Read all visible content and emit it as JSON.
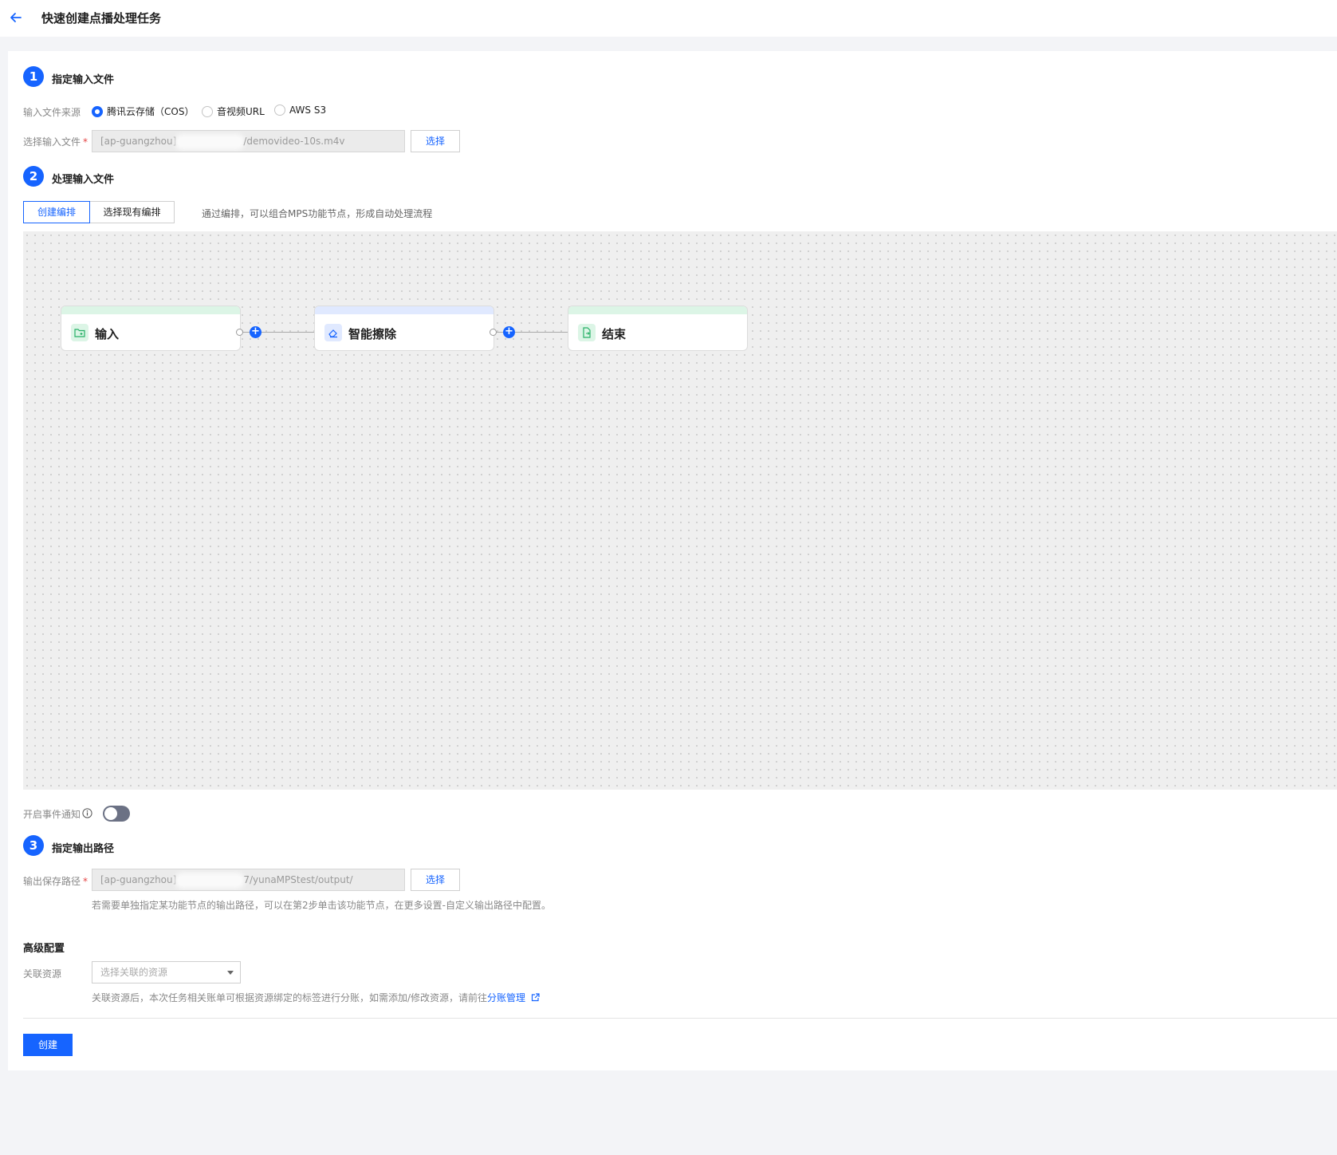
{
  "header": {
    "title": "快速创建点播处理任务"
  },
  "step1": {
    "number": "1",
    "title": "指定输入文件",
    "source_label": "输入文件来源",
    "sources": [
      "腾讯云存储（COS）",
      "音视频URL",
      "AWS S3"
    ],
    "selected_source": "腾讯云存储（COS）",
    "file_label": "选择输入文件",
    "file_prefix": "[ap-guangzhou]",
    "file_suffix": "/demovideo-10s.m4v",
    "select_button": "选择"
  },
  "step2": {
    "number": "2",
    "title": "处理输入文件",
    "tabs": [
      "创建编排",
      "选择现有编排"
    ],
    "active_tab": "创建编排",
    "hint": "通过编排，可以组合MPS功能节点，形成自动处理流程",
    "nodes": [
      {
        "label": "输入",
        "icon": "folder-add-icon",
        "color": "#dcf5e6"
      },
      {
        "label": "智能擦除",
        "icon": "eraser-icon",
        "color": "#e0e9ff"
      },
      {
        "label": "结束",
        "icon": "file-export-icon",
        "color": "#dcf5e6"
      }
    ],
    "event_notify_label": "开启事件通知",
    "event_notify_on": false
  },
  "step3": {
    "number": "3",
    "title": "指定输出路径",
    "path_label": "输出保存路径",
    "path_prefix": "[ap-guangzhou]",
    "path_suffix": "7/yunaMPStest/output/",
    "select_button": "选择",
    "path_hint": "若需要单独指定某功能节点的输出路径，可以在第2步单击该功能节点，在更多设置-自定义输出路径中配置。"
  },
  "advanced": {
    "title": "高级配置",
    "resource_label": "关联资源",
    "resource_placeholder": "选择关联的资源",
    "resource_hint": "关联资源后，本次任务相关账单可根据资源绑定的标签进行分账，如需添加/修改资源，请前往",
    "resource_link": "分账管理"
  },
  "footer": {
    "create_button": "创建"
  },
  "colors": {
    "accent": "#1664ff",
    "required": "#e54545"
  }
}
